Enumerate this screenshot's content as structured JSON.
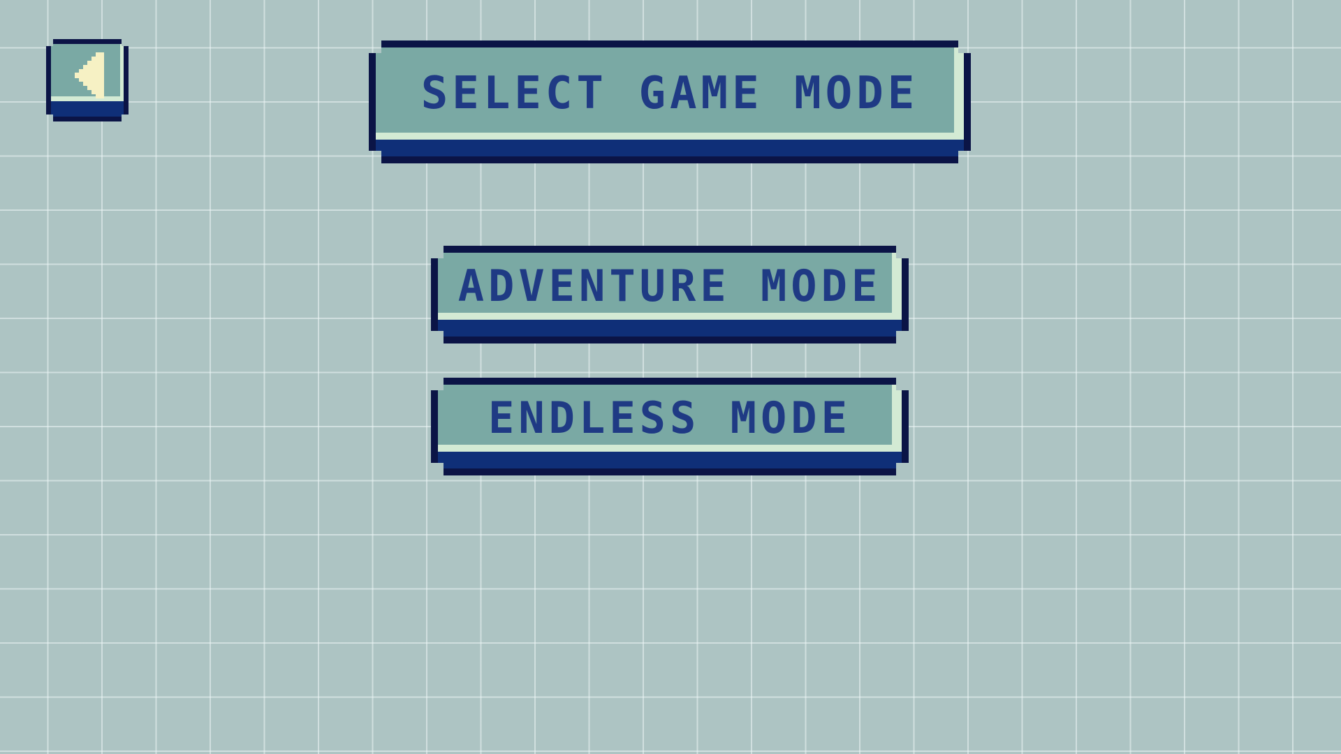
{
  "screen": {
    "title": "SELECT GAME MODE"
  },
  "back_button": {
    "icon": "triangle-left-icon",
    "icon_color": "#f6f1c4"
  },
  "modes": [
    {
      "label": "ADVENTURE MODE"
    },
    {
      "label": "ENDLESS MODE"
    }
  ],
  "colors": {
    "background": "#adc4c3",
    "grid_line": "#eef6f6",
    "panel_fill": "#7aa9a4",
    "panel_outline": "#0b1446",
    "panel_shadow": "#0f2f78",
    "panel_highlight": "#d3ead4",
    "text": "#1f3a84"
  }
}
